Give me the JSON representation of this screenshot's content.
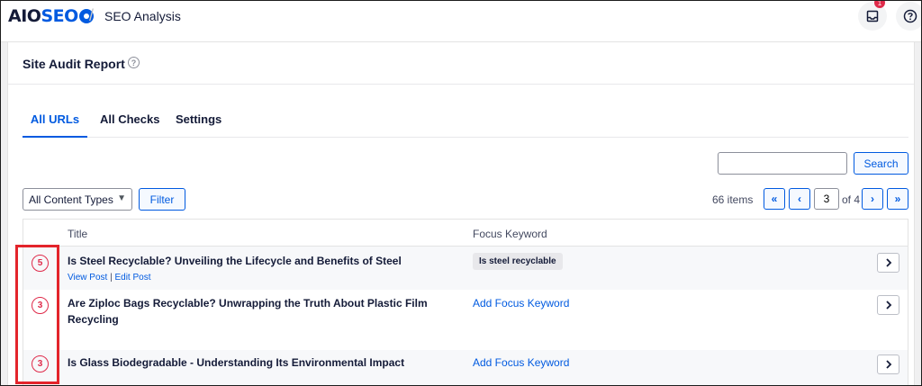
{
  "header": {
    "logo_part1": "AIO",
    "logo_part2": "SEO",
    "separator": "/",
    "title": "SEO Analysis",
    "notification_count": "1",
    "icons": [
      "inbox-icon",
      "help-icon"
    ]
  },
  "card": {
    "title": "Site Audit Report",
    "help_glyph": "?"
  },
  "tabs": [
    {
      "label": "All URLs",
      "active": true
    },
    {
      "label": "All Checks",
      "active": false
    },
    {
      "label": "Settings",
      "active": false
    }
  ],
  "search": {
    "value": "",
    "placeholder": "",
    "button_label": "Search"
  },
  "filter": {
    "select_value": "All Content Types",
    "button_label": "Filter"
  },
  "pagination": {
    "items_count": "66 items",
    "first": "«",
    "prev": "‹",
    "current_page": "3",
    "of_label": "of 4",
    "next": "›",
    "last": "»"
  },
  "table": {
    "columns": [
      "Title",
      "Focus Keyword"
    ],
    "rows": [
      {
        "score": "5",
        "title": "Is Steel Recyclable? Unveiling the Lifecycle and Benefits of Steel",
        "view_link": "View Post",
        "action_sep": "|",
        "edit_link": "Edit Post",
        "keyword": "Is steel recyclable"
      },
      {
        "score": "3",
        "title": "Are Ziploc Bags Recyclable? Unwrapping the Truth About Plastic Film Recycling",
        "keyword_link": "Add Focus Keyword"
      },
      {
        "score": "3",
        "title": "Is Glass Biodegradable - Understanding Its Environmental Impact",
        "keyword_link": "Add Focus Keyword"
      }
    ]
  },
  "colors": {
    "accent": "#005ae0",
    "score_red": "#df2a4a",
    "highlight": "#e3242b"
  }
}
